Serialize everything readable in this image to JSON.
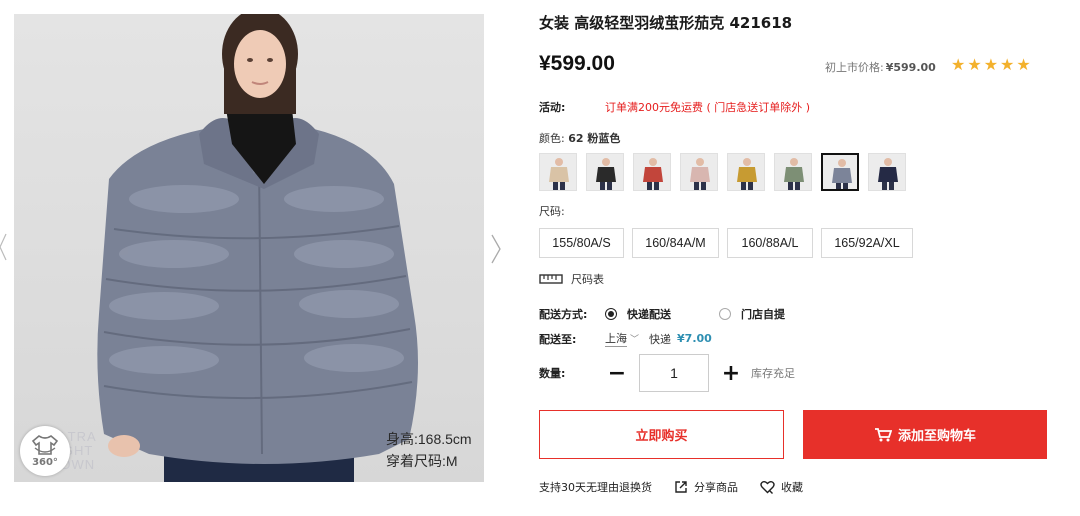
{
  "product": {
    "title": "女装 高级轻型羽绒茧形茄克 421618",
    "price": "¥599.00",
    "original_price_label": "初上市价格:",
    "original_price": "¥599.00",
    "stars": "★★★★★",
    "rating": 5,
    "star_color": "#f3b12c"
  },
  "promo": {
    "label": "活动:",
    "text": "订单满200元免运费 ( 门店急送订单除外 )"
  },
  "color": {
    "label": "颜色:",
    "selected": "62 粉蓝色",
    "swatches": [
      {
        "name": "swatch-beige",
        "main": "#d9c3a6"
      },
      {
        "name": "swatch-black",
        "main": "#2a2a2a"
      },
      {
        "name": "swatch-red",
        "main": "#c2453b"
      },
      {
        "name": "swatch-pink",
        "main": "#d8b6b0"
      },
      {
        "name": "swatch-mustard",
        "main": "#c79b32"
      },
      {
        "name": "swatch-green",
        "main": "#7d8f75"
      },
      {
        "name": "swatch-powder-blue",
        "main": "#7c8499"
      },
      {
        "name": "swatch-navy",
        "main": "#252a45"
      }
    ]
  },
  "size": {
    "label": "尺码:",
    "options": [
      "155/80A/S",
      "160/84A/M",
      "160/88A/L",
      "165/92A/XL"
    ],
    "chart_label": "尺码表"
  },
  "shipping": {
    "label": "配送方式:",
    "option_express": "快递配送",
    "option_pickup": "门店自提",
    "dest_label": "配送至:",
    "city": "上海",
    "fee_label": "快递",
    "fee": "¥7.00"
  },
  "quantity": {
    "label": "数量:",
    "minus": "−",
    "plus": "+",
    "value": "1",
    "stock": "库存充足"
  },
  "buttons": {
    "buy_now": "立即购买",
    "add_to_cart": "添加至购物车"
  },
  "footer": {
    "returns": "支持30天无理由退换货",
    "share": "分享商品",
    "favorite": "收藏"
  },
  "gallery": {
    "badge_360": "360°",
    "ultra_lines": [
      "ULTRA",
      "LIGHT",
      "DOWN"
    ],
    "model_height": "身高:168.5cm",
    "model_size": "穿着尺码:M"
  },
  "colors": {
    "accent": "#e7302a",
    "promo_red": "#e61e1e",
    "fee_blue": "#2e8fb2"
  }
}
